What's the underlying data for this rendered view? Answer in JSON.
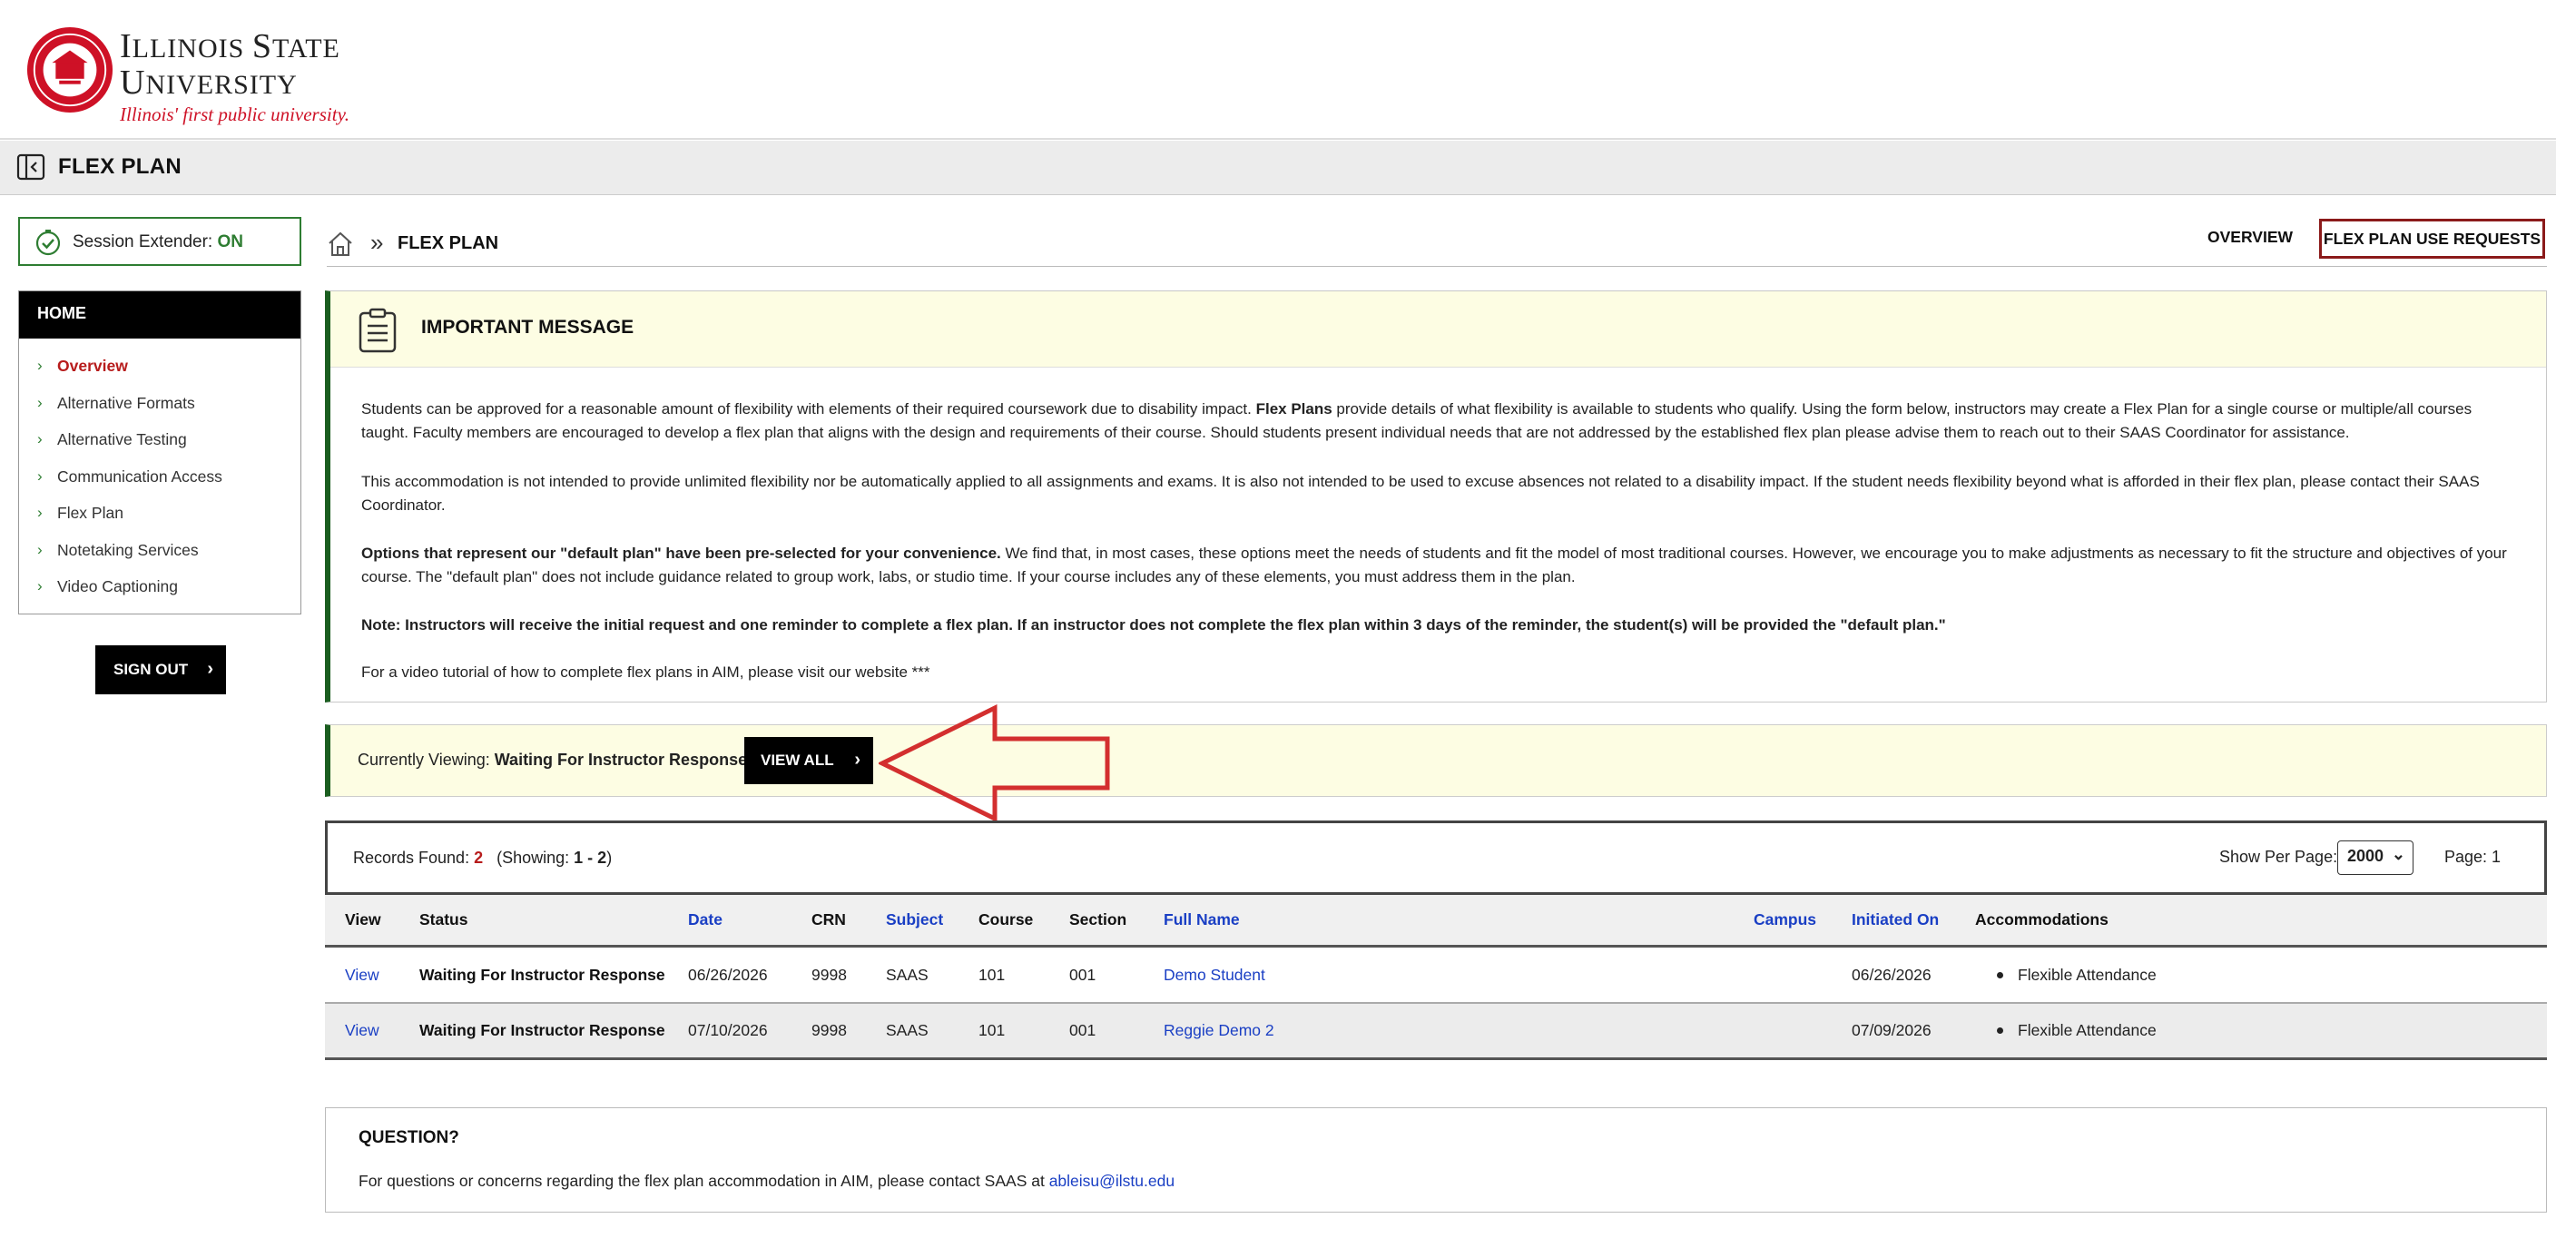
{
  "header": {
    "logo_line1_cap": "I",
    "logo_line1_rest": "LLINOIS ",
    "logo_line1_cap2": "S",
    "logo_line1_rest2": "TATE",
    "logo_line2_cap": "U",
    "logo_line2_rest": "NIVERSITY",
    "tagline": "Illinois' first public university."
  },
  "title_bar": {
    "title": "FLEX PLAN"
  },
  "sidebar": {
    "session_label": "Session Extender: ",
    "session_state": "ON",
    "nav_heading": "HOME",
    "items": [
      {
        "label": "Overview",
        "active": true
      },
      {
        "label": "Alternative Formats"
      },
      {
        "label": "Alternative Testing"
      },
      {
        "label": "Communication Access"
      },
      {
        "label": "Flex Plan"
      },
      {
        "label": "Notetaking Services"
      },
      {
        "label": "Video Captioning"
      }
    ],
    "signout_label": "SIGN OUT"
  },
  "breadcrumb": {
    "separator": "»",
    "current": "FLEX PLAN"
  },
  "top_links": {
    "overview": "OVERVIEW",
    "requests": "FLEX PLAN USE REQUESTS"
  },
  "message": {
    "title": "IMPORTANT MESSAGE",
    "p1_pre": "Students can be approved for a reasonable amount of flexibility with elements of their required coursework due to disability impact. ",
    "p1_bold": "Flex Plans",
    "p1_post": " provide details of what flexibility is available to students who qualify. Using the form below, instructors may create a Flex Plan for a single course or multiple/all courses taught. Faculty members are encouraged to develop a flex plan that aligns with the design and requirements of their course. Should students present individual needs that are not addressed by the established flex plan please advise them to reach out to their SAAS Coordinator for assistance.",
    "p2": "This accommodation is not intended to provide unlimited flexibility nor be automatically applied to all assignments and exams. It is also not intended to be used to excuse absences not related to a disability impact. If the student needs flexibility beyond what is afforded in their flex plan, please contact their SAAS Coordinator.",
    "p3_bold": "Options that represent our \"default plan\" have been pre-selected for your convenience.",
    "p3_post": " We find that, in most cases, these options meet the needs of students and fit the model of most traditional courses. However, we encourage you to make adjustments as necessary to fit the structure and objectives of your course. The \"default plan\" does not include guidance related to group work, labs, or studio time. If your course includes any of these elements, you must address them in the plan.",
    "p4": "Note: Instructors will receive the initial request and one reminder to complete a flex plan. If an instructor does not complete the flex plan within 3 days of the reminder, the student(s) will be provided the \"default plan.\"",
    "p5": "For a video tutorial of how to complete flex plans in AIM, please visit our website ***"
  },
  "viewing": {
    "label": "Currently Viewing: ",
    "value": "Waiting For Instructor Response",
    "button": "VIEW ALL"
  },
  "records": {
    "label": "Records Found: ",
    "count": "2",
    "showing_pre": "(Showing: ",
    "showing_range": "1 - 2",
    "showing_post": ")",
    "per_page_label": "Show Per Page:",
    "per_page_value": "2000",
    "page_label": "Page: 1"
  },
  "table": {
    "headers": {
      "view": "View",
      "status": "Status",
      "date": "Date",
      "crn": "CRN",
      "subject": "Subject",
      "course": "Course",
      "section": "Section",
      "full_name": "Full Name",
      "campus": "Campus",
      "initiated_on": "Initiated On",
      "accommodations": "Accommodations"
    },
    "rows": [
      {
        "view": "View",
        "status": "Waiting For Instructor Response",
        "date": "06/26/2026",
        "crn": "9998",
        "subject": "SAAS",
        "course": "101",
        "section": "001",
        "full_name": "Demo Student",
        "campus": "",
        "initiated_on": "06/26/2026",
        "accommodation": "Flexible Attendance"
      },
      {
        "view": "View",
        "status": "Waiting For Instructor Response",
        "date": "07/10/2026",
        "crn": "9998",
        "subject": "SAAS",
        "course": "101",
        "section": "001",
        "full_name": "Reggie Demo 2",
        "campus": "",
        "initiated_on": "07/09/2026",
        "accommodation": "Flexible Attendance"
      }
    ]
  },
  "question": {
    "title": "QUESTION?",
    "text": "For questions or concerns regarding the flex plan accommodation in AIM, please contact SAAS at ",
    "email": "ableisu@ilstu.edu"
  },
  "colors": {
    "brand_red": "#ce1126",
    "accent_green": "#2e7d32",
    "link_blue": "#1a3fc4",
    "message_bg": "#fdfde3"
  },
  "icons": [
    "university-seal",
    "sidebar-collapse-icon",
    "session-check-icon",
    "home-icon",
    "message-clipboard-icon",
    "chevron-right-icon",
    "red-arrow-annotation"
  ]
}
